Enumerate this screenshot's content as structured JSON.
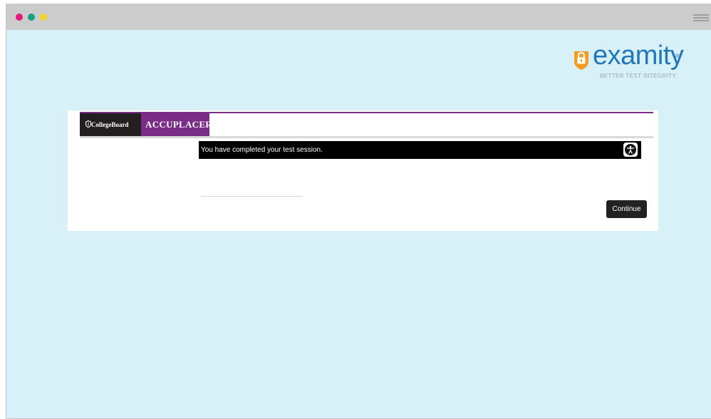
{
  "window": {
    "controls": [
      {
        "name": "close",
        "color": "#e8197d"
      },
      {
        "name": "minimize",
        "color": "#16a085"
      },
      {
        "name": "maximize",
        "color": "#f5d327"
      }
    ],
    "menu_icon": "hamburger-icon"
  },
  "brand": {
    "name": "examity",
    "registered": "®",
    "tagline": "BETTER TEST INTEGRITY.",
    "icon": "padlock-icon",
    "color": "#2277b8",
    "icon_color": "#f39c1f"
  },
  "header": {
    "collegeboard_label": "CollegeBoard",
    "collegeboard_icon": "acorn-icon",
    "accuplacer_label": "ACCUPLACER",
    "accuplacer_mark": "·",
    "accent_color": "#7a2d87"
  },
  "message": {
    "text": "You have completed your test session.",
    "accessibility_icon": "accessibility-icon"
  },
  "actions": {
    "continue_label": "Continue"
  }
}
